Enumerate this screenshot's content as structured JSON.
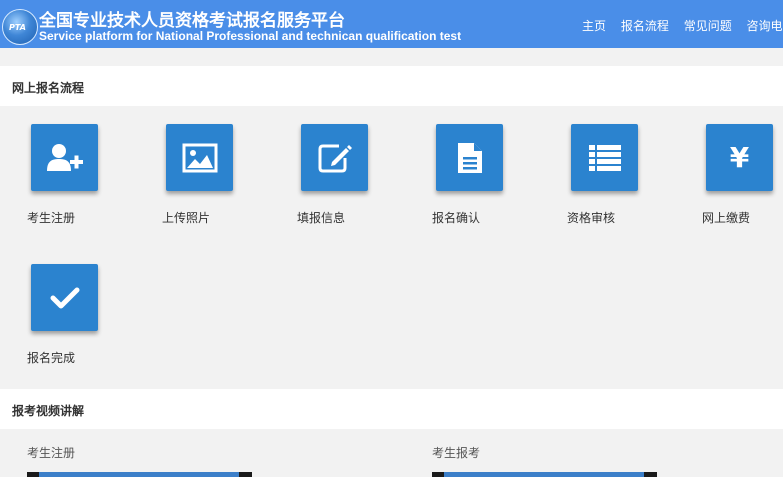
{
  "header": {
    "title_cn": "全国专业技术人员资格考试报名服务平台",
    "title_en": "Service platform for National Professional and technican qualification test",
    "logo_text": "PTA",
    "nav": [
      "主页",
      "报名流程",
      "常见问题",
      "咨询电话"
    ]
  },
  "process": {
    "title": "网上报名流程",
    "steps": [
      {
        "label": "考生注册",
        "icon": "add-user-icon"
      },
      {
        "label": "上传照片",
        "icon": "image-icon"
      },
      {
        "label": "填报信息",
        "icon": "edit-icon"
      },
      {
        "label": "报名确认",
        "icon": "document-icon"
      },
      {
        "label": "资格审核",
        "icon": "list-icon"
      },
      {
        "label": "网上缴费",
        "icon": "yen-icon"
      },
      {
        "label": "报名完成",
        "icon": "check-icon"
      }
    ]
  },
  "videos": {
    "title": "报考视频讲解",
    "items": [
      {
        "label": "考生注册"
      },
      {
        "label": "考生报考"
      }
    ]
  },
  "colors": {
    "header": "#4a8ee8",
    "tile": "#2b83cf",
    "background": "#f2f2f2"
  }
}
